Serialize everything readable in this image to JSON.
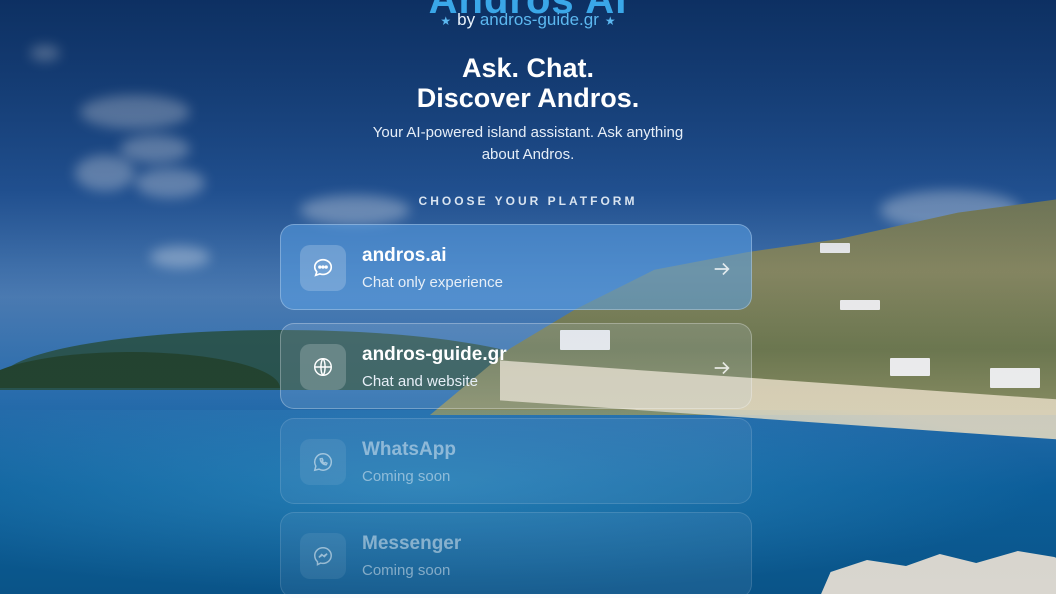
{
  "brand": {
    "title": "Andros AI",
    "by_prefix": "by",
    "by_site_main": "andros-",
    "by_site_accent": "guide.gr",
    "accent_color": "#3aa7e8"
  },
  "hero": {
    "headline_line1": "Ask. Chat.",
    "headline_line2": "Discover Andros.",
    "subtitle_line1": "Your AI-powered island assistant. Ask anything",
    "subtitle_line2": "about Andros."
  },
  "platforms": {
    "heading": "CHOOSE YOUR PLATFORM",
    "items": [
      {
        "name": "andros.ai",
        "description": "Chat only experience",
        "icon": "chat-bubble-icon",
        "state": "active"
      },
      {
        "name": "andros-guide.gr",
        "description": "Chat and website",
        "icon": "globe-icon",
        "state": "active"
      },
      {
        "name": "WhatsApp",
        "description": "Coming soon",
        "icon": "whatsapp-icon",
        "state": "disabled"
      },
      {
        "name": "Messenger",
        "description": "Coming soon",
        "icon": "messenger-icon",
        "state": "disabled"
      }
    ]
  }
}
